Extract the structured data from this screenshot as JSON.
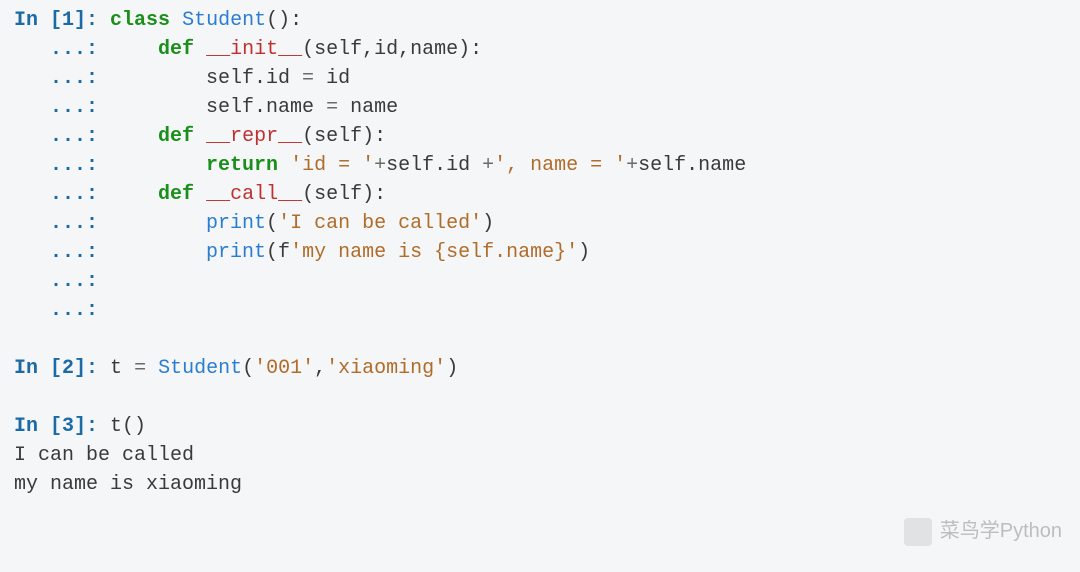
{
  "cells": [
    {
      "prompt": {
        "label": "In",
        "num": "1"
      },
      "lines": [
        {
          "gutter": "In [1]: ",
          "tokens": [
            {
              "cls": "kw-green",
              "t": "class"
            },
            {
              "cls": "plain",
              "t": " "
            },
            {
              "cls": "fn-blue",
              "t": "Student"
            },
            {
              "cls": "plain",
              "t": "():"
            }
          ]
        },
        {
          "gutter": "   ...: ",
          "tokens": [
            {
              "cls": "plain",
              "t": "    "
            },
            {
              "cls": "kw-def",
              "t": "def"
            },
            {
              "cls": "plain",
              "t": " "
            },
            {
              "cls": "name-red",
              "t": "__init__"
            },
            {
              "cls": "plain",
              "t": "(self,id,name):"
            }
          ]
        },
        {
          "gutter": "   ...: ",
          "tokens": [
            {
              "cls": "plain",
              "t": "        self.id "
            },
            {
              "cls": "op",
              "t": "="
            },
            {
              "cls": "plain",
              "t": " id"
            }
          ]
        },
        {
          "gutter": "   ...: ",
          "tokens": [
            {
              "cls": "plain",
              "t": "        self.name "
            },
            {
              "cls": "op",
              "t": "="
            },
            {
              "cls": "plain",
              "t": " name"
            }
          ]
        },
        {
          "gutter": "   ...: ",
          "tokens": [
            {
              "cls": "plain",
              "t": "    "
            },
            {
              "cls": "kw-def",
              "t": "def"
            },
            {
              "cls": "plain",
              "t": " "
            },
            {
              "cls": "name-red",
              "t": "__repr__"
            },
            {
              "cls": "plain",
              "t": "(self):"
            }
          ]
        },
        {
          "gutter": "   ...: ",
          "tokens": [
            {
              "cls": "plain",
              "t": "        "
            },
            {
              "cls": "kw-green",
              "t": "return"
            },
            {
              "cls": "plain",
              "t": " "
            },
            {
              "cls": "str",
              "t": "'id = '"
            },
            {
              "cls": "op",
              "t": "+"
            },
            {
              "cls": "plain",
              "t": "self.id "
            },
            {
              "cls": "op",
              "t": "+"
            },
            {
              "cls": "str",
              "t": "', name = '"
            },
            {
              "cls": "op",
              "t": "+"
            },
            {
              "cls": "plain",
              "t": "self.name"
            }
          ]
        },
        {
          "gutter": "   ...: ",
          "tokens": [
            {
              "cls": "plain",
              "t": "    "
            },
            {
              "cls": "kw-def",
              "t": "def"
            },
            {
              "cls": "plain",
              "t": " "
            },
            {
              "cls": "name-red",
              "t": "__call__"
            },
            {
              "cls": "plain",
              "t": "(self):"
            }
          ]
        },
        {
          "gutter": "   ...: ",
          "tokens": [
            {
              "cls": "plain",
              "t": "        "
            },
            {
              "cls": "fn-blue",
              "t": "print"
            },
            {
              "cls": "plain",
              "t": "("
            },
            {
              "cls": "str",
              "t": "'I can be called'"
            },
            {
              "cls": "plain",
              "t": ")"
            }
          ]
        },
        {
          "gutter": "   ...: ",
          "tokens": [
            {
              "cls": "plain",
              "t": "        "
            },
            {
              "cls": "fn-blue",
              "t": "print"
            },
            {
              "cls": "plain",
              "t": "(f"
            },
            {
              "cls": "str",
              "t": "'my name is {self.name}'"
            },
            {
              "cls": "plain",
              "t": ")"
            }
          ]
        },
        {
          "gutter": "   ...: ",
          "tokens": []
        },
        {
          "gutter": "   ...: ",
          "tokens": []
        }
      ],
      "trailing_blank": true
    },
    {
      "prompt": {
        "label": "In",
        "num": "2"
      },
      "lines": [
        {
          "gutter": "In [2]: ",
          "tokens": [
            {
              "cls": "plain",
              "t": "t "
            },
            {
              "cls": "op",
              "t": "="
            },
            {
              "cls": "plain",
              "t": " "
            },
            {
              "cls": "fn-blue",
              "t": "Student"
            },
            {
              "cls": "plain",
              "t": "("
            },
            {
              "cls": "str",
              "t": "'001'"
            },
            {
              "cls": "plain",
              "t": ","
            },
            {
              "cls": "str",
              "t": "'xiaoming'"
            },
            {
              "cls": "plain",
              "t": ")"
            }
          ]
        }
      ],
      "trailing_blank": true
    },
    {
      "prompt": {
        "label": "In",
        "num": "3"
      },
      "lines": [
        {
          "gutter": "In [3]: ",
          "tokens": [
            {
              "cls": "plain",
              "t": "t()"
            }
          ]
        }
      ],
      "output": [
        "I can be called",
        "my name is xiaoming"
      ],
      "trailing_blank": false
    }
  ],
  "watermark": {
    "text": "菜鸟学Python"
  }
}
